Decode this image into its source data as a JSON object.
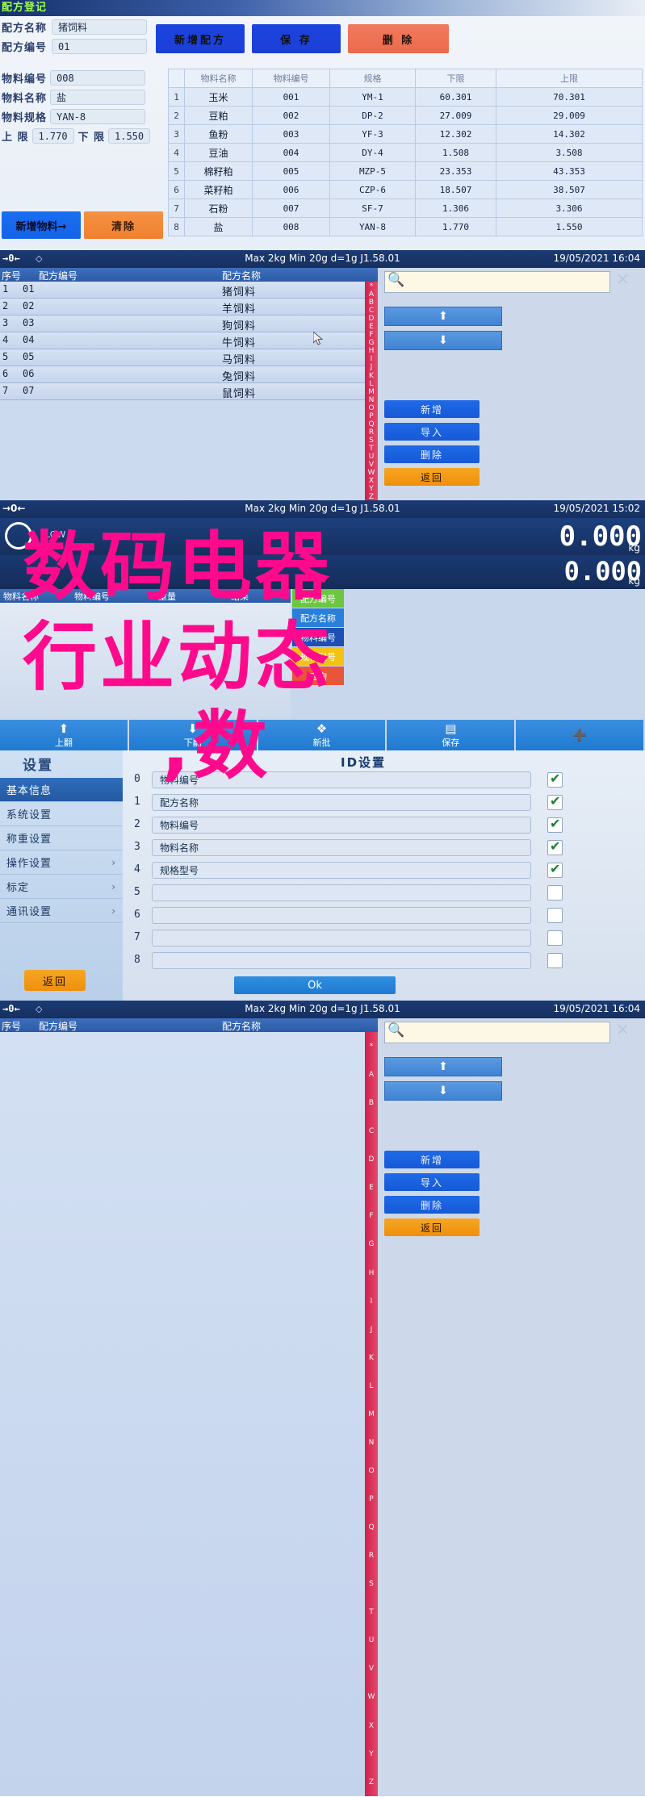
{
  "panel1": {
    "title": "配方登记",
    "fields": [
      {
        "label": "配方名称",
        "value": "猪饲料"
      },
      {
        "label": "配方编号",
        "value": "01"
      },
      {
        "label": "物料编号",
        "value": "008"
      },
      {
        "label": "物料名称",
        "value": "盐"
      },
      {
        "label": "物料规格",
        "value": "YAN-8"
      }
    ],
    "limit_upper_label": "上    限",
    "limit_upper_value": "1.770",
    "limit_lower_label": "下    限",
    "limit_lower_value": "1.550",
    "buttons": {
      "add_recipe": "新增配方",
      "save": "保  存",
      "delete": "删  除",
      "add_material": "新增物料→",
      "clear": "清除"
    },
    "table": {
      "headers": [
        "",
        "物料名称",
        "物料编号",
        "规格",
        "下限",
        "上限"
      ],
      "rows": [
        [
          "1",
          "玉米",
          "001",
          "YM-1",
          "60.301",
          "70.301"
        ],
        [
          "2",
          "豆粕",
          "002",
          "DP-2",
          "27.009",
          "29.009"
        ],
        [
          "3",
          "鱼粉",
          "003",
          "YF-3",
          "12.302",
          "14.302"
        ],
        [
          "4",
          "豆油",
          "004",
          "DY-4",
          "1.508",
          "3.508"
        ],
        [
          "5",
          "棉籽粕",
          "005",
          "MZP-5",
          "23.353",
          "43.353"
        ],
        [
          "6",
          "菜籽粕",
          "006",
          "CZP-6",
          "18.507",
          "38.507"
        ],
        [
          "7",
          "石粉",
          "007",
          "SF-7",
          "1.306",
          "3.306"
        ],
        [
          "8",
          "盐",
          "008",
          "YAN-8",
          "1.770",
          "1.550"
        ]
      ]
    }
  },
  "scale": {
    "zero_indicator": "→0←",
    "spec": "Max 2kg  Min 20g  d=1g    J1.58.01",
    "datetime": "19/05/2021  16:04",
    "headers": {
      "index": "序号",
      "code": "配方编号",
      "name": "配方名称"
    },
    "rows": [
      {
        "index": "1",
        "code": "01",
        "name": "猪饲料"
      },
      {
        "index": "2",
        "code": "02",
        "name": "羊饲料"
      },
      {
        "index": "3",
        "code": "03",
        "name": "狗饲料"
      },
      {
        "index": "4",
        "code": "04",
        "name": "牛饲料"
      },
      {
        "index": "5",
        "code": "05",
        "name": "马饲料"
      },
      {
        "index": "6",
        "code": "06",
        "name": "兔饲料"
      },
      {
        "index": "7",
        "code": "07",
        "name": "鼠饲料"
      }
    ],
    "alphabet": "*ABCDEFGHIJKLMNOPQRSTUVWXYZ",
    "search_value": "",
    "side_buttons": {
      "add": "新增",
      "import": "导入",
      "delete": "删除",
      "back": "返回"
    },
    "icons": {
      "search": "search-icon",
      "close": "close-icon",
      "up": "arrow-up-icon",
      "down": "arrow-down-icon"
    }
  },
  "panel3": {
    "spec": "Max 2kg  Min 20g  d=1g    J1.58.01",
    "datetime": "19/05/2021  15:02",
    "weight_gross": "0.000",
    "weight_net": "0.000",
    "unit": "kg",
    "low_flag": "LOW",
    "table_headers": [
      "物料名称",
      "物料编号",
      "重量",
      "结果"
    ],
    "tiles": [
      {
        "label": "配方编号",
        "color": "#6cc63f"
      },
      {
        "label": "配方名称",
        "color": "#2a7fd8"
      },
      {
        "label": "物料编号",
        "color": "#1f4fb0"
      },
      {
        "label": "规格型号",
        "color": "#f2c316"
      },
      {
        "label": "查询",
        "color": "#e8553a"
      }
    ],
    "bottom_buttons": [
      {
        "label": "上翻",
        "icon": "arrow-up-icon",
        "color": "#1f7ad0"
      },
      {
        "label": "下翻",
        "icon": "arrow-down-icon",
        "color": "#1f7ad0"
      },
      {
        "label": "新批",
        "icon": "batch-icon",
        "color": "#1f7ad0"
      },
      {
        "label": "保存",
        "icon": "save-icon",
        "color": "#1f7ad0"
      },
      {
        "label": "",
        "icon": "plus-icon",
        "color": "#1f7ad0"
      }
    ]
  },
  "panel4": {
    "side_title": "设置",
    "side_items": [
      {
        "label": "基本信息",
        "selected": true,
        "chev": false
      },
      {
        "label": "系统设置",
        "selected": false,
        "chev": false
      },
      {
        "label": "称重设置",
        "selected": false,
        "chev": false
      },
      {
        "label": "操作设置",
        "selected": false,
        "chev": true
      },
      {
        "label": "标定",
        "selected": false,
        "chev": true
      },
      {
        "label": "通讯设置",
        "selected": false,
        "chev": true
      }
    ],
    "back_button": "返回",
    "dialog_title": "ID设置",
    "rows": [
      {
        "n": "0",
        "value": "物料编号",
        "checked": true,
        "placeholder": ""
      },
      {
        "n": "1",
        "value": "配方名称",
        "checked": true,
        "placeholder": ""
      },
      {
        "n": "2",
        "value": "物料编号",
        "checked": true,
        "placeholder": ""
      },
      {
        "n": "3",
        "value": "物料名称",
        "checked": true,
        "placeholder": ""
      },
      {
        "n": "4",
        "value": "规格型号",
        "checked": true,
        "placeholder": ""
      },
      {
        "n": "5",
        "value": "",
        "checked": false,
        "placeholder": ""
      },
      {
        "n": "6",
        "value": "",
        "checked": false,
        "placeholder": ""
      },
      {
        "n": "7",
        "value": "",
        "checked": false,
        "placeholder": ""
      },
      {
        "n": "8",
        "value": "",
        "checked": false,
        "placeholder": ""
      }
    ],
    "ok_button": "Ok"
  },
  "watermark": {
    "line1": "数码电器",
    "line2": "行业动态",
    "line3": ",数",
    "color": "#ff0a8c"
  }
}
